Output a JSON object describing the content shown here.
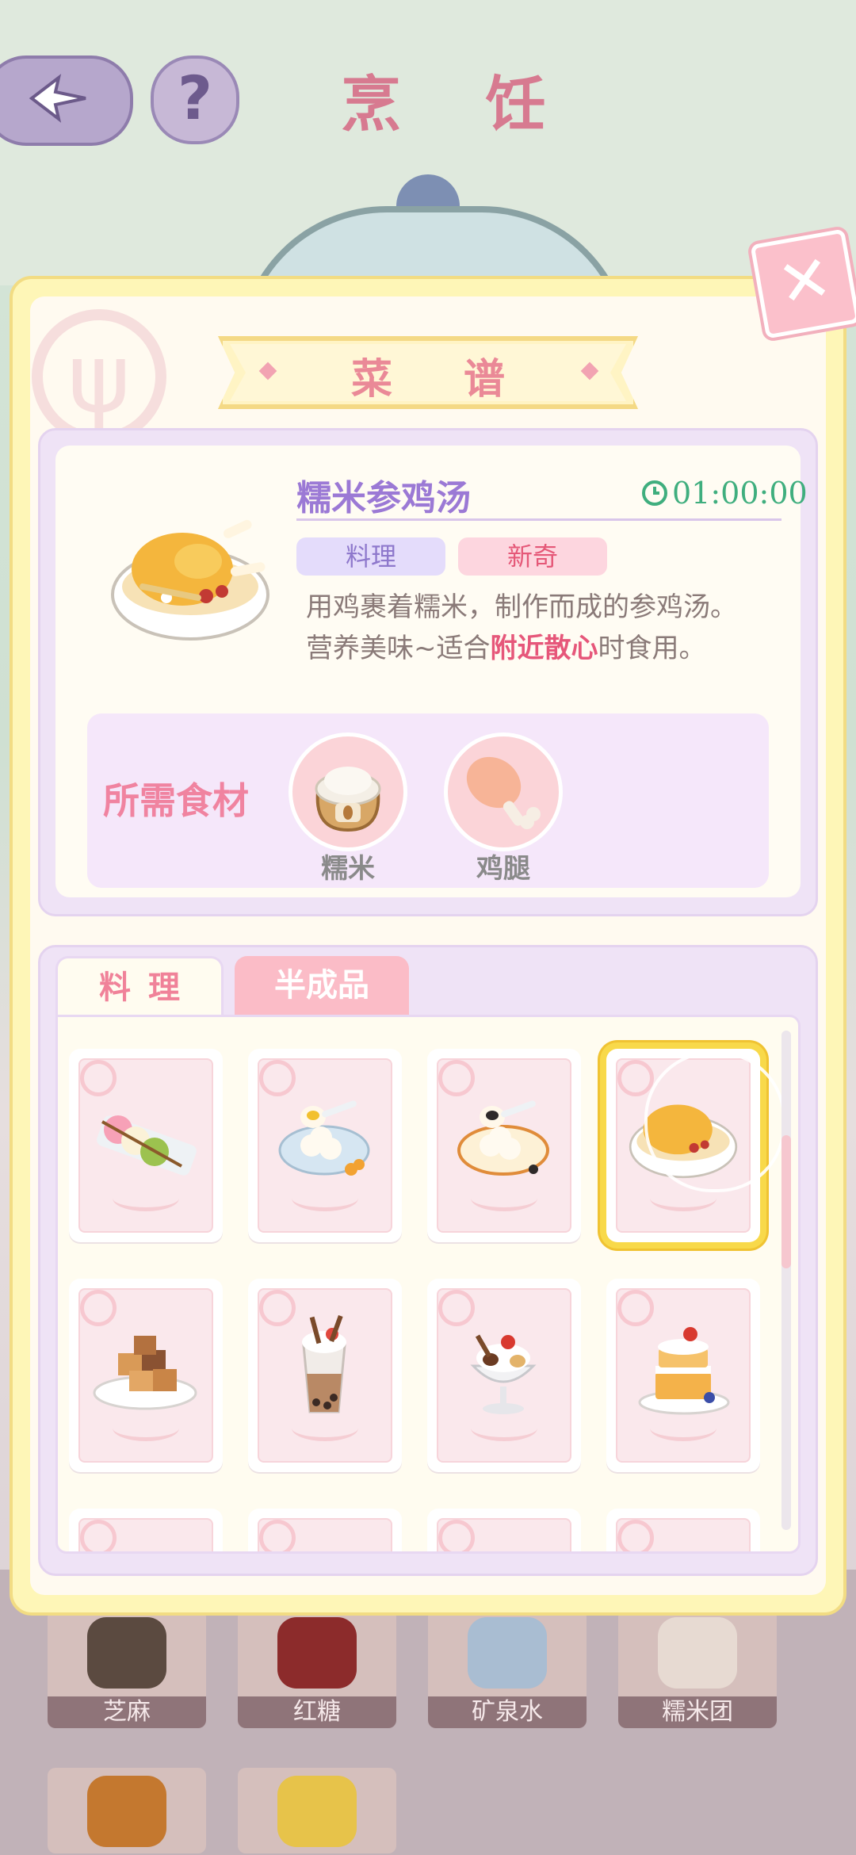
{
  "background": {
    "title": "烹 饪",
    "ingredient_cards": [
      {
        "label": "芝麻"
      },
      {
        "label": "红糖"
      },
      {
        "label": "矿泉水"
      },
      {
        "label": "糯米团"
      }
    ]
  },
  "dialog": {
    "title": "菜 谱",
    "close_icon": "close-icon",
    "recipe": {
      "name": "糯米参鸡汤",
      "timer": "01:00:00",
      "tags": [
        "料理",
        "新奇"
      ],
      "description_line1": "用鸡裹着糯米，制作而成的参鸡汤。",
      "description_line2_pre": "营养美味~适合",
      "description_line2_highlight": "附近散心",
      "description_line2_post": "时食用。",
      "ingredients_label": "所需食材",
      "ingredients": [
        {
          "name": "糯米",
          "icon": "rice-sack-icon"
        },
        {
          "name": "鸡腿",
          "icon": "chicken-leg-icon"
        }
      ]
    },
    "tabs": [
      {
        "label": "料理",
        "active": true
      },
      {
        "label": "半成品",
        "active": false
      }
    ],
    "dishes": [
      {
        "icon": "dango-icon"
      },
      {
        "icon": "tangyuan-icon"
      },
      {
        "icon": "sesame-tangyuan-icon"
      },
      {
        "icon": "ginseng-chicken-soup-icon",
        "selected": true
      },
      {
        "icon": "toast-cubes-icon"
      },
      {
        "icon": "bubble-tea-icon"
      },
      {
        "icon": "sundae-icon"
      },
      {
        "icon": "strawberry-cake-icon"
      }
    ]
  },
  "colors": {
    "accent_pink": "#ea8997",
    "accent_purple": "#9b79d5",
    "timer_green": "#3fae7e",
    "highlight_red": "#e6577a",
    "selected_gold": "#f8d94a"
  }
}
